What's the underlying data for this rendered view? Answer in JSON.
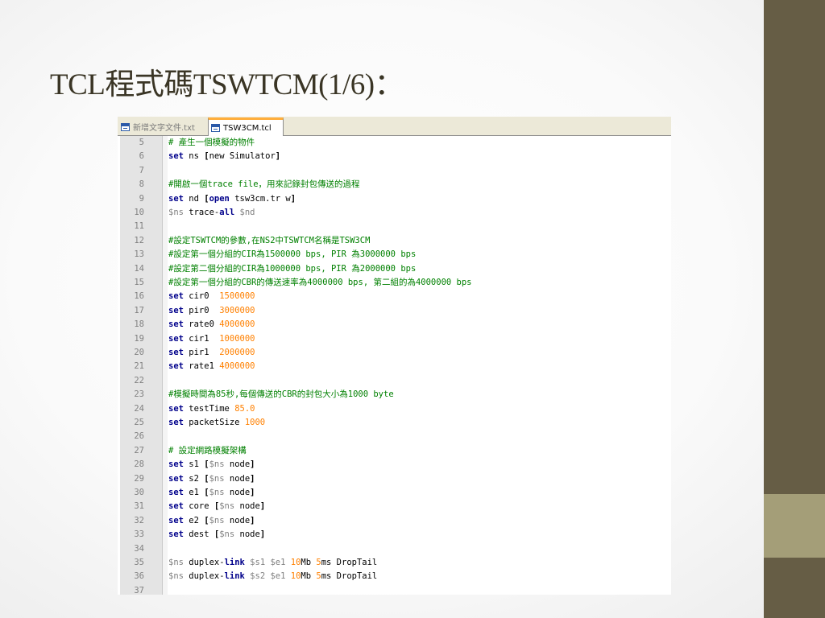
{
  "slide": {
    "title": "TCL程式碼TSWTCM(1/6)："
  },
  "editor": {
    "tabs": [
      {
        "label": "新增文字文件.txt",
        "active": false,
        "icon": "file-icon"
      },
      {
        "label": "TSW3CM.tcl",
        "active": true,
        "icon": "file-icon"
      }
    ],
    "lines": [
      {
        "num": "5",
        "tokens": [
          [
            "cm",
            "# 產生一個模擬的物件"
          ]
        ]
      },
      {
        "num": "6",
        "tokens": [
          [
            "kw",
            "set"
          ],
          [
            "txt",
            " ns "
          ],
          [
            "op",
            "["
          ],
          [
            "txt",
            "new Simulator"
          ],
          [
            "op",
            "]"
          ]
        ]
      },
      {
        "num": "7",
        "tokens": []
      },
      {
        "num": "8",
        "tokens": [
          [
            "cm",
            "#開啟一個trace file，用來記錄封包傳送的過程"
          ]
        ]
      },
      {
        "num": "9",
        "tokens": [
          [
            "kw",
            "set"
          ],
          [
            "txt",
            " nd "
          ],
          [
            "op",
            "["
          ],
          [
            "kw",
            "open"
          ],
          [
            "txt",
            " tsw3cm.tr w"
          ],
          [
            "op",
            "]"
          ]
        ]
      },
      {
        "num": "10",
        "tokens": [
          [
            "var",
            "$ns"
          ],
          [
            "txt",
            " trace-"
          ],
          [
            "kw",
            "all"
          ],
          [
            "txt",
            " "
          ],
          [
            "var",
            "$nd"
          ]
        ]
      },
      {
        "num": "11",
        "tokens": []
      },
      {
        "num": "12",
        "tokens": [
          [
            "cm",
            "#設定TSWTCM的參數,在NS2中TSWTCM名稱是TSW3CM"
          ]
        ]
      },
      {
        "num": "13",
        "tokens": [
          [
            "cm",
            "#設定第一個分組的CIR為1500000 bps, PIR 為3000000 bps"
          ]
        ]
      },
      {
        "num": "14",
        "tokens": [
          [
            "cm",
            "#設定第二個分組的CIR為1000000 bps, PIR 為2000000 bps"
          ]
        ]
      },
      {
        "num": "15",
        "tokens": [
          [
            "cm",
            "#設定第一個分組的CBR的傳送速率為4000000 bps, 第二組的為4000000 bps"
          ]
        ]
      },
      {
        "num": "16",
        "tokens": [
          [
            "kw",
            "set"
          ],
          [
            "txt",
            " cir0  "
          ],
          [
            "num",
            "1500000"
          ]
        ]
      },
      {
        "num": "17",
        "tokens": [
          [
            "kw",
            "set"
          ],
          [
            "txt",
            " pir0  "
          ],
          [
            "num",
            "3000000"
          ]
        ]
      },
      {
        "num": "18",
        "tokens": [
          [
            "kw",
            "set"
          ],
          [
            "txt",
            " rate0 "
          ],
          [
            "num",
            "4000000"
          ]
        ]
      },
      {
        "num": "19",
        "tokens": [
          [
            "kw",
            "set"
          ],
          [
            "txt",
            " cir1  "
          ],
          [
            "num",
            "1000000"
          ]
        ]
      },
      {
        "num": "20",
        "tokens": [
          [
            "kw",
            "set"
          ],
          [
            "txt",
            " pir1  "
          ],
          [
            "num",
            "2000000"
          ]
        ]
      },
      {
        "num": "21",
        "tokens": [
          [
            "kw",
            "set"
          ],
          [
            "txt",
            " rate1 "
          ],
          [
            "num",
            "4000000"
          ]
        ]
      },
      {
        "num": "22",
        "tokens": []
      },
      {
        "num": "23",
        "tokens": [
          [
            "cm",
            "#模擬時間為85秒,每個傳送的CBR的封包大小為1000 byte"
          ]
        ]
      },
      {
        "num": "24",
        "tokens": [
          [
            "kw",
            "set"
          ],
          [
            "txt",
            " testTime "
          ],
          [
            "num",
            "85.0"
          ]
        ]
      },
      {
        "num": "25",
        "tokens": [
          [
            "kw",
            "set"
          ],
          [
            "txt",
            " packetSize "
          ],
          [
            "num",
            "1000"
          ]
        ]
      },
      {
        "num": "26",
        "tokens": []
      },
      {
        "num": "27",
        "tokens": [
          [
            "cm",
            "# 設定網路模擬架構"
          ]
        ]
      },
      {
        "num": "28",
        "tokens": [
          [
            "kw",
            "set"
          ],
          [
            "txt",
            " s1 "
          ],
          [
            "op",
            "["
          ],
          [
            "var",
            "$ns"
          ],
          [
            "txt",
            " node"
          ],
          [
            "op",
            "]"
          ]
        ]
      },
      {
        "num": "29",
        "tokens": [
          [
            "kw",
            "set"
          ],
          [
            "txt",
            " s2 "
          ],
          [
            "op",
            "["
          ],
          [
            "var",
            "$ns"
          ],
          [
            "txt",
            " node"
          ],
          [
            "op",
            "]"
          ]
        ]
      },
      {
        "num": "30",
        "tokens": [
          [
            "kw",
            "set"
          ],
          [
            "txt",
            " e1 "
          ],
          [
            "op",
            "["
          ],
          [
            "var",
            "$ns"
          ],
          [
            "txt",
            " node"
          ],
          [
            "op",
            "]"
          ]
        ]
      },
      {
        "num": "31",
        "tokens": [
          [
            "kw",
            "set"
          ],
          [
            "txt",
            " core "
          ],
          [
            "op",
            "["
          ],
          [
            "var",
            "$ns"
          ],
          [
            "txt",
            " node"
          ],
          [
            "op",
            "]"
          ]
        ]
      },
      {
        "num": "32",
        "tokens": [
          [
            "kw",
            "set"
          ],
          [
            "txt",
            " e2 "
          ],
          [
            "op",
            "["
          ],
          [
            "var",
            "$ns"
          ],
          [
            "txt",
            " node"
          ],
          [
            "op",
            "]"
          ]
        ]
      },
      {
        "num": "33",
        "tokens": [
          [
            "kw",
            "set"
          ],
          [
            "txt",
            " dest "
          ],
          [
            "op",
            "["
          ],
          [
            "var",
            "$ns"
          ],
          [
            "txt",
            " node"
          ],
          [
            "op",
            "]"
          ]
        ]
      },
      {
        "num": "34",
        "tokens": []
      },
      {
        "num": "35",
        "tokens": [
          [
            "var",
            "$ns"
          ],
          [
            "txt",
            " duplex-"
          ],
          [
            "kw",
            "link"
          ],
          [
            "txt",
            " "
          ],
          [
            "var",
            "$s1"
          ],
          [
            "txt",
            " "
          ],
          [
            "var",
            "$e1"
          ],
          [
            "txt",
            " "
          ],
          [
            "num",
            "10"
          ],
          [
            "txt",
            "Mb "
          ],
          [
            "num",
            "5"
          ],
          [
            "txt",
            "ms DropTail"
          ]
        ]
      },
      {
        "num": "36",
        "tokens": [
          [
            "var",
            "$ns"
          ],
          [
            "txt",
            " duplex-"
          ],
          [
            "kw",
            "link"
          ],
          [
            "txt",
            " "
          ],
          [
            "var",
            "$s2"
          ],
          [
            "txt",
            " "
          ],
          [
            "var",
            "$e1"
          ],
          [
            "txt",
            " "
          ],
          [
            "num",
            "10"
          ],
          [
            "txt",
            "Mb "
          ],
          [
            "num",
            "5"
          ],
          [
            "txt",
            "ms DropTail"
          ]
        ]
      },
      {
        "num": "37",
        "tokens": []
      }
    ]
  },
  "colors": {
    "sidebar": "#665d45",
    "sidebar_accent": "#a49e78",
    "title": "#3a3525",
    "keyword": "#00008b",
    "comment": "#008000",
    "number": "#ff8000",
    "variable": "#808080",
    "active_tab_marker": "#ffae3c"
  }
}
